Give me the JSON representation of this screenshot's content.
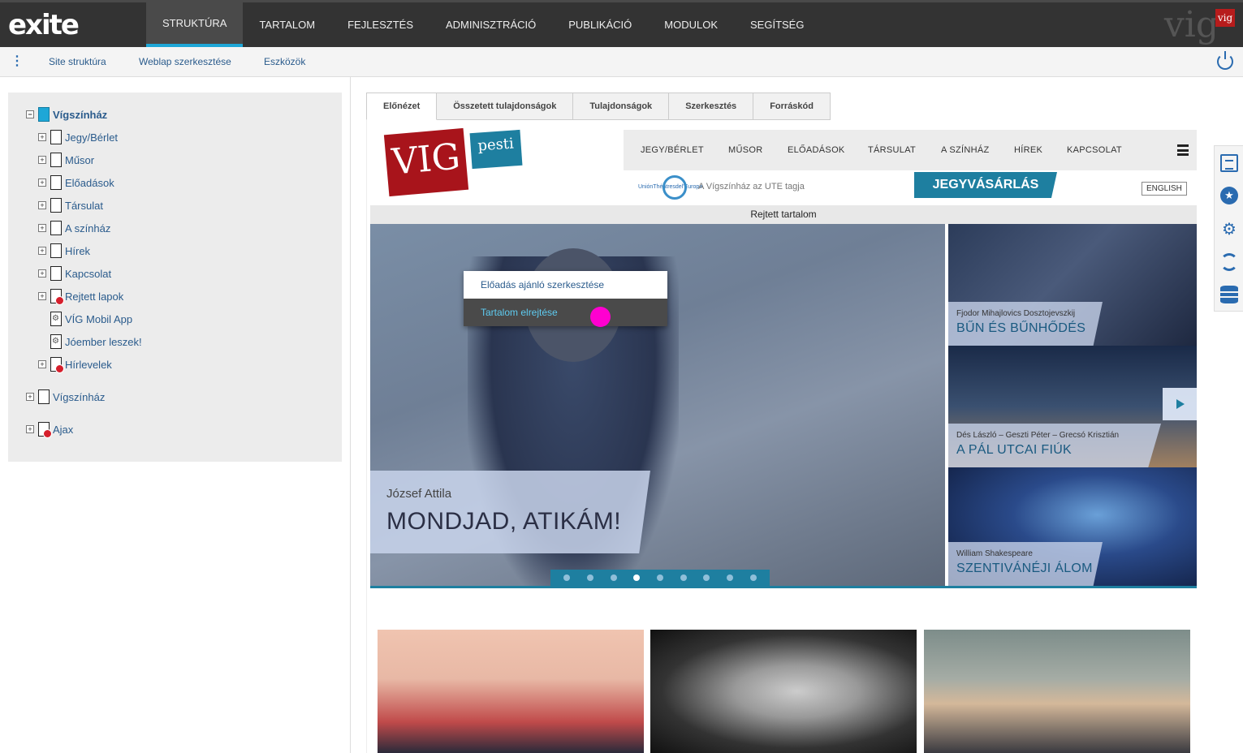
{
  "app": {
    "logo": "exite",
    "brand": "vig",
    "brand_badge": "vig"
  },
  "main_nav": [
    {
      "label": "STRUKTÚRA",
      "active": true
    },
    {
      "label": "TARTALOM"
    },
    {
      "label": "FEJLESZTÉS"
    },
    {
      "label": "ADMINISZTRÁCIÓ"
    },
    {
      "label": "PUBLIKÁCIÓ"
    },
    {
      "label": "MODULOK"
    },
    {
      "label": "SEGÍTSÉG"
    }
  ],
  "sub_nav": [
    {
      "label": "Site struktúra"
    },
    {
      "label": "Weblap szerkesztése"
    },
    {
      "label": "Eszközök"
    }
  ],
  "tree": {
    "root": "Vígszínház",
    "children": [
      {
        "label": "Jegy/Bérlet"
      },
      {
        "label": "Műsor"
      },
      {
        "label": "Előadások"
      },
      {
        "label": "Társulat"
      },
      {
        "label": "A színház"
      },
      {
        "label": "Hírek"
      },
      {
        "label": "Kapcsolat"
      },
      {
        "label": "Rejtett lapok"
      },
      {
        "label": "VÍG Mobil App"
      },
      {
        "label": "Jóember leszek!"
      },
      {
        "label": "Hírlevelek"
      }
    ],
    "other_roots": [
      {
        "label": "Vígszínház"
      },
      {
        "label": "Ajax"
      }
    ]
  },
  "tabs": [
    {
      "label": "Előnézet",
      "active": true
    },
    {
      "label": "Összetett tulajdonságok"
    },
    {
      "label": "Tulajdonságok"
    },
    {
      "label": "Szerkesztés"
    },
    {
      "label": "Forráskód"
    }
  ],
  "site": {
    "logo": "VIG",
    "pesti": "pesti",
    "nav": [
      "JEGY/BÉRLET",
      "MŰSOR",
      "ELŐADÁSOK",
      "TÁRSULAT",
      "A SZÍNHÁZ",
      "HÍREK",
      "KAPCSOLAT"
    ],
    "ute_logo": "UniónThéâtresdel'Europe",
    "ute_text": "A Vígszínház az UTE tagja",
    "ticket_button": "JEGYVÁSÁRLÁS",
    "english_button": "ENGLISH",
    "hidden_bar": "Rejtett tartalom",
    "hero": {
      "author": "József Attila",
      "title": "MONDJAD, ATIKÁM!"
    },
    "slider_dots": 9,
    "slider_active": 4,
    "side_items": [
      {
        "author": "Fjodor Mihajlovics Dosztojevszkij",
        "title": "BŰN ÉS BŰNHŐDÉS"
      },
      {
        "author": "Dés László – Geszti Péter – Grecsó Krisztián",
        "title": "A PÁL UTCAI FIÚK"
      },
      {
        "author": "William Shakespeare",
        "title": "SZENTIVÁNÉJI ÁLOM"
      }
    ]
  },
  "context_menu": {
    "items": [
      {
        "label": "Előadás ajánló szerkesztése"
      },
      {
        "label": "Tartalom elrejtése",
        "highlighted": true
      }
    ]
  },
  "rail_icons": [
    "clipboard-icon",
    "star-icon",
    "gears-icon",
    "sync-icon",
    "database-icon"
  ],
  "colors": {
    "topbar": "#333333",
    "accent": "#1ea7d7",
    "site_teal": "#1e7fa0",
    "site_red": "#a8141b",
    "cursor": "#ff00d0"
  }
}
